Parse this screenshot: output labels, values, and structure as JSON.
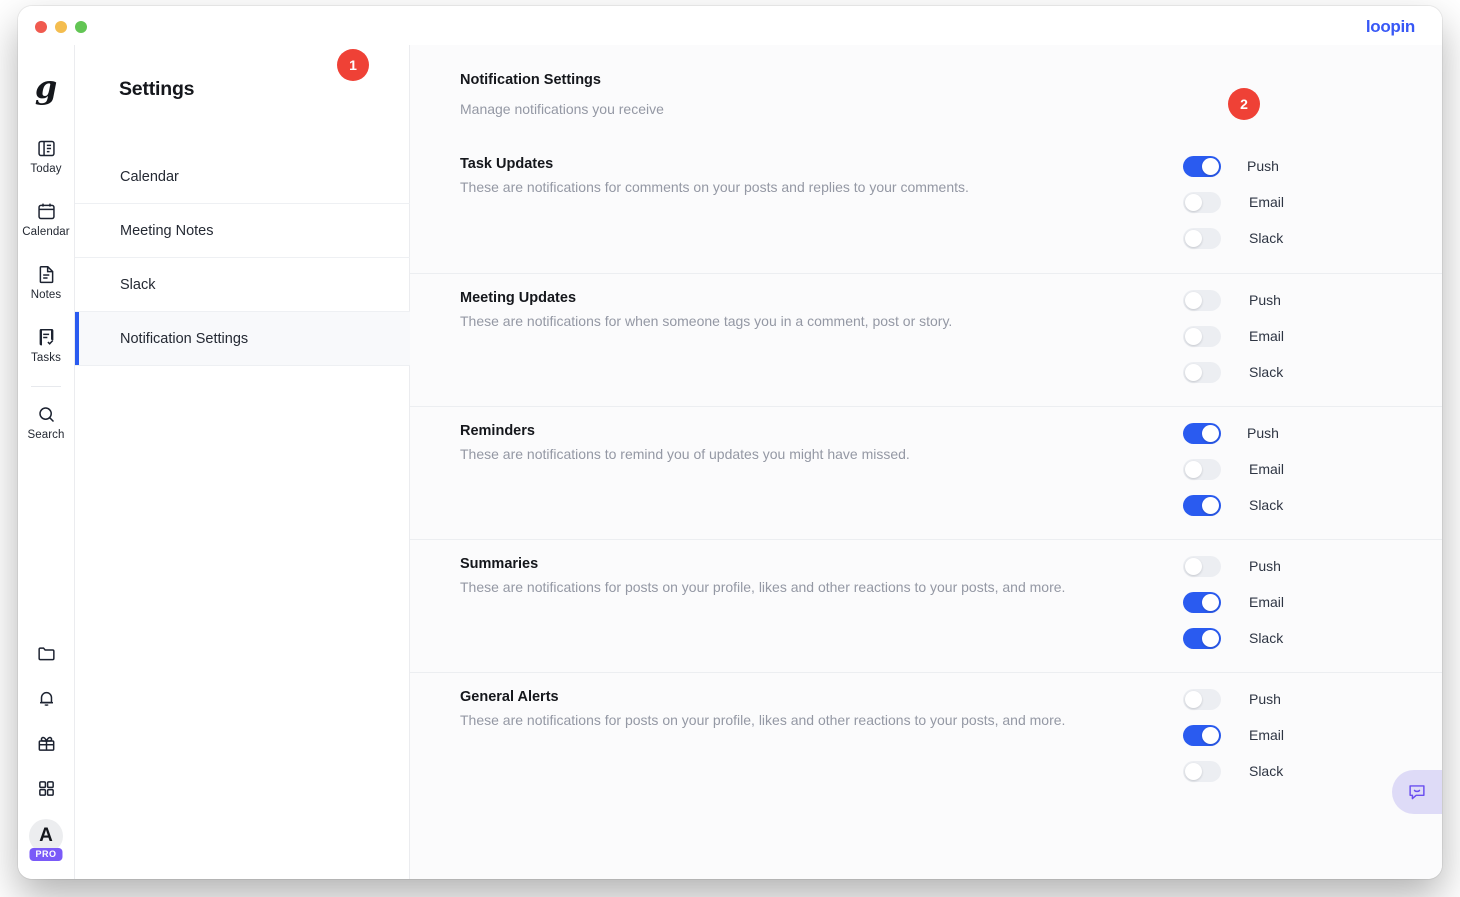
{
  "window": {
    "brand": "loopin",
    "traffic_lights": [
      "close",
      "minimize",
      "zoom"
    ],
    "colors": {
      "accent_blue": "#2a5bf0",
      "brand_blue": "#3858f6",
      "badge_red": "#ef4136",
      "pro_purple": "#7a5af8",
      "panel_bg": "#fbfbfc"
    }
  },
  "rail": {
    "logo": "loopin-g-logo",
    "items": [
      {
        "label": "Today",
        "icon": "today-book-icon"
      },
      {
        "label": "Calendar",
        "icon": "calendar-icon"
      },
      {
        "label": "Notes",
        "icon": "notes-document-icon"
      },
      {
        "label": "Tasks",
        "icon": "tasks-checklist-icon"
      },
      {
        "label": "Search",
        "icon": "search-magnifier-icon"
      }
    ],
    "mini_items": [
      {
        "icon": "folder-icon"
      },
      {
        "icon": "bell-icon"
      },
      {
        "icon": "gift-icon"
      },
      {
        "icon": "grid-apps-icon"
      }
    ],
    "account": {
      "initial": "A",
      "plan_badge": "PRO"
    }
  },
  "settings": {
    "title": "Settings",
    "items": [
      {
        "label": "Calendar",
        "active": false
      },
      {
        "label": "Meeting Notes",
        "active": false
      },
      {
        "label": "Slack",
        "active": false
      },
      {
        "label": "Notification Settings",
        "active": true
      }
    ]
  },
  "main": {
    "title": "Notification Settings",
    "subtitle": "Manage notifications you receive",
    "sections": [
      {
        "title": "Task Updates",
        "description": "These are notifications for comments on your posts and replies to your comments.",
        "channels": [
          {
            "label": "Push",
            "on": true
          },
          {
            "label": "Email",
            "on": false
          },
          {
            "label": "Slack",
            "on": false
          }
        ]
      },
      {
        "title": "Meeting Updates",
        "description": "These are notifications for when someone tags you in a comment, post or story.",
        "channels": [
          {
            "label": "Push",
            "on": false
          },
          {
            "label": "Email",
            "on": false
          },
          {
            "label": "Slack",
            "on": false
          }
        ]
      },
      {
        "title": "Reminders",
        "description": "These are notifications to remind you of updates you might have missed.",
        "channels": [
          {
            "label": "Push",
            "on": true
          },
          {
            "label": "Email",
            "on": false
          },
          {
            "label": "Slack",
            "on": true
          }
        ]
      },
      {
        "title": "Summaries",
        "description": "These are notifications for posts on your profile, likes and other reactions to your posts, and more.",
        "channels": [
          {
            "label": "Push",
            "on": false
          },
          {
            "label": "Email",
            "on": true
          },
          {
            "label": "Slack",
            "on": true
          }
        ]
      },
      {
        "title": "General Alerts",
        "description": "These are notifications for posts on your profile, likes and other reactions to your posts, and more.",
        "channels": [
          {
            "label": "Push",
            "on": false
          },
          {
            "label": "Email",
            "on": true
          },
          {
            "label": "Slack",
            "on": false
          }
        ]
      }
    ]
  },
  "annotations": [
    {
      "id": "1",
      "label": "1"
    },
    {
      "id": "2",
      "label": "2"
    }
  ],
  "chat_widget": {
    "icon": "chat-smiley-bubble-icon"
  }
}
